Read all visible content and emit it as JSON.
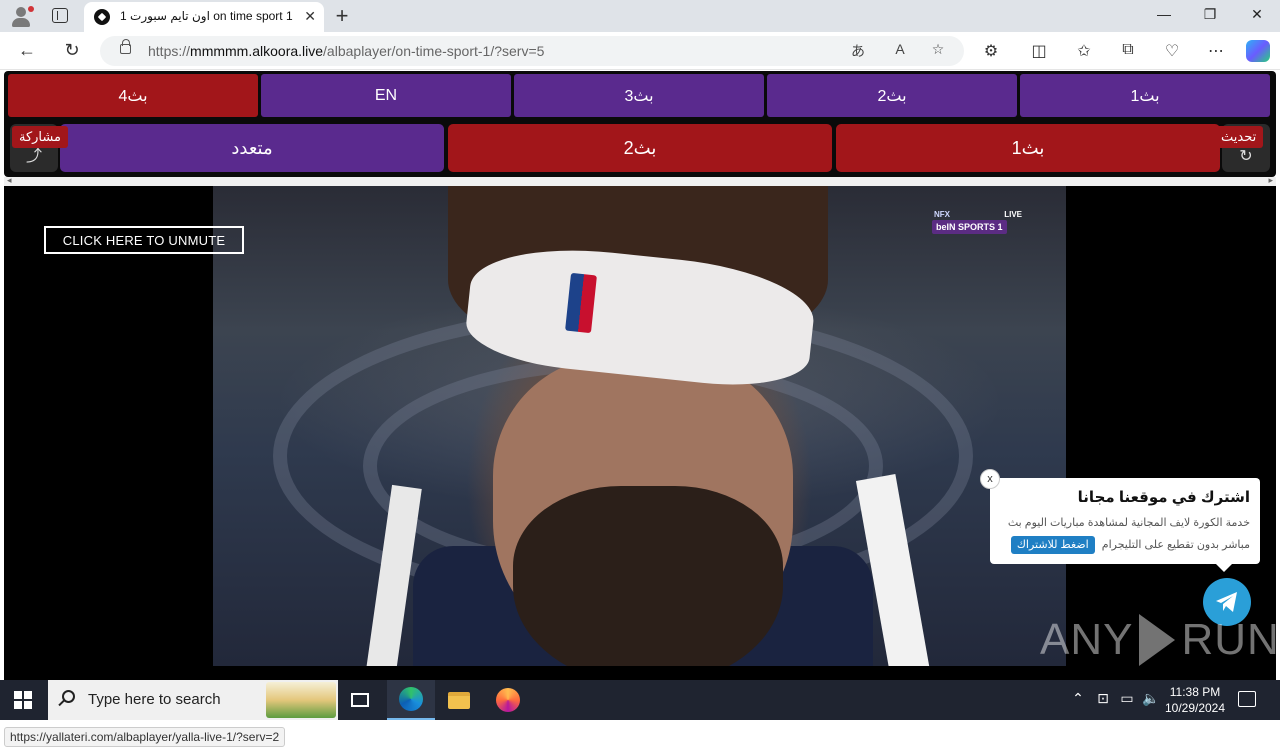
{
  "browser": {
    "tab_title": "اون تايم سبورت 1 on time sport 1",
    "url_prefix": "https://",
    "url_host": "mmmmm.alkoora.live",
    "url_path": "/albaplayer/on-time-sport-1/?serv=5",
    "status_url": "https://yallateri.com/albaplayer/yalla-live-1/?serv=2"
  },
  "servers": [
    {
      "label": "بث4",
      "color": "red"
    },
    {
      "label": "EN",
      "color": "purple"
    },
    {
      "label": "بث3",
      "color": "purple"
    },
    {
      "label": "بث2",
      "color": "purple"
    },
    {
      "label": "بث1",
      "color": "purple"
    }
  ],
  "broadcasts": [
    {
      "label": "متعدد",
      "color": "purple"
    },
    {
      "label": "بث2",
      "color": "red"
    },
    {
      "label": "بث1",
      "color": "red"
    }
  ],
  "share_label": "مشاركة",
  "refresh_label": "تحديث",
  "player": {
    "unmute_label": "CLICK HERE TO UNMUTE",
    "channel_live": "LIVE",
    "channel_brand": "beIN SPORTS 1",
    "channel_nfx": "NFX"
  },
  "popup": {
    "title": "اشترك في موقعنا مجانا",
    "line1": "خدمة الكورة لايف المجانية لمشاهدة مباريات اليوم بث",
    "line2": "مباشر بدون تقطيع على التليجرام",
    "cta": "اضغط للاشتراك",
    "close": "x"
  },
  "watermark": {
    "left": "ANY",
    "right": "RUN"
  },
  "taskbar": {
    "search_placeholder": "Type here to search",
    "time": "11:38 PM",
    "date": "10/29/2024"
  },
  "colors": {
    "purple": "#5a2a8e",
    "red": "#a2161a",
    "telegram": "#2a9fd8"
  }
}
